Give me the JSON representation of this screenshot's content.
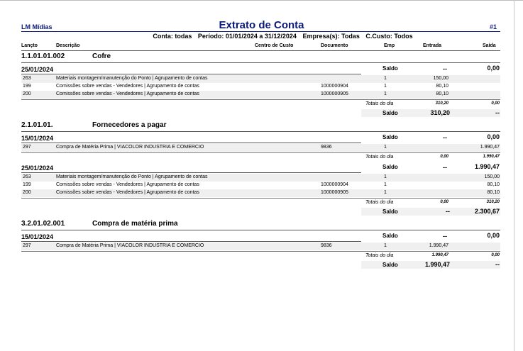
{
  "header": {
    "company": "LM Mídias",
    "title": "Extrato de Conta",
    "page": "#1",
    "filters": [
      "Conta: todas",
      "Período: 01/01/2024 a 31/12/2024",
      "Empresa(s): Todas",
      "C.Custo: Todos"
    ]
  },
  "columns": {
    "lancto": "Lançto",
    "descricao": "Descrição",
    "centro_custo": "Centro de Custo",
    "documento": "Documento",
    "emp": "Emp",
    "entrada": "Entrada",
    "saida": "Saída"
  },
  "labels": {
    "saldo": "Saldo",
    "totais": "Totais do dia",
    "dash": "--"
  },
  "accounts": [
    {
      "code": "1.1.01.01.002",
      "name": "Cofre",
      "days": [
        {
          "date": "25/01/2024",
          "saldo_entrada": "--",
          "saldo_saida": "0,00",
          "rows": [
            {
              "lancto": "263",
              "desc": "Materiais montagem/manutenção do Ponto | Agrupamento de contas",
              "doc": "",
              "emp": "1",
              "entrada": "150,00",
              "saida": ""
            },
            {
              "lancto": "199",
              "desc": "Comissões sobre vendas - Vendedores | Agrupamento de contas",
              "doc": "1000000904",
              "emp": "1",
              "entrada": "80,10",
              "saida": ""
            },
            {
              "lancto": "200",
              "desc": "Comissões sobre vendas - Vendedores | Agrupamento de contas",
              "doc": "1000000905",
              "emp": "1",
              "entrada": "80,10",
              "saida": ""
            }
          ],
          "tot_entrada": "310,20",
          "tot_saida": "0,00",
          "final_entrada": "310,20",
          "final_saida": "--"
        }
      ]
    },
    {
      "code": "2.1.01.01.",
      "name": "Fornecedores a pagar",
      "days": [
        {
          "date": "15/01/2024",
          "saldo_entrada": "--",
          "saldo_saida": "0,00",
          "rows": [
            {
              "lancto": "297",
              "desc": "Compra de Matéria Prima | VIACOLOR INDUSTRIA E COMERCIO",
              "doc": "9836",
              "emp": "1",
              "entrada": "",
              "saida": "1.990,47"
            }
          ],
          "tot_entrada": "0,00",
          "tot_saida": "1.990,47"
        },
        {
          "date": "25/01/2024",
          "saldo_entrada": "--",
          "saldo_saida": "1.990,47",
          "rows": [
            {
              "lancto": "263",
              "desc": "Materiais montagem/manutenção do Ponto | Agrupamento de contas",
              "doc": "",
              "emp": "1",
              "entrada": "",
              "saida": "150,00"
            },
            {
              "lancto": "199",
              "desc": "Comissões sobre vendas - Vendedores | Agrupamento de contas",
              "doc": "1000000904",
              "emp": "1",
              "entrada": "",
              "saida": "80,10"
            },
            {
              "lancto": "200",
              "desc": "Comissões sobre vendas - Vendedores | Agrupamento de contas",
              "doc": "1000000905",
              "emp": "1",
              "entrada": "",
              "saida": "80,10"
            }
          ],
          "tot_entrada": "0,00",
          "tot_saida": "310,20",
          "final_entrada": "--",
          "final_saida": "2.300,67"
        }
      ]
    },
    {
      "code": "3.2.01.02.001",
      "name": "Compra de matéria prima",
      "days": [
        {
          "date": "15/01/2024",
          "saldo_entrada": "--",
          "saldo_saida": "0,00",
          "rows": [
            {
              "lancto": "297",
              "desc": "Compra de Matéria Prima | VIACOLOR INDUSTRIA E COMERCIO",
              "doc": "9836",
              "emp": "1",
              "entrada": "1.990,47",
              "saida": ""
            }
          ],
          "tot_entrada": "1.990,47",
          "tot_saida": "0,00",
          "final_entrada": "1.990,47",
          "final_saida": "--"
        }
      ]
    }
  ]
}
